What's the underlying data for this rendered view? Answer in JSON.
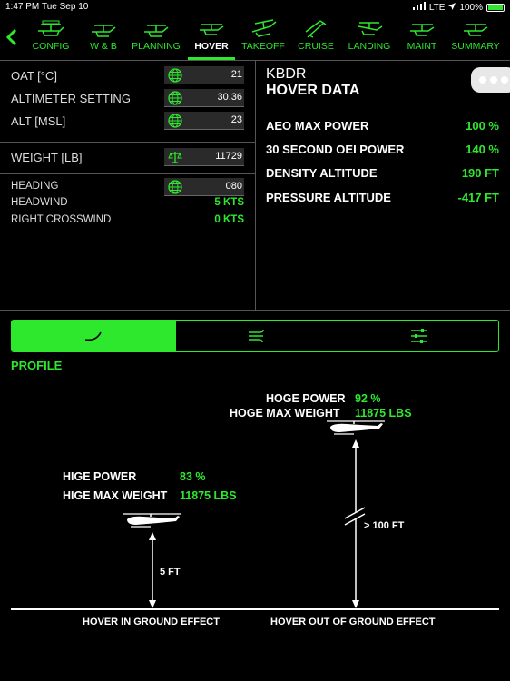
{
  "status": {
    "time": "1:47 PM",
    "date": "Tue Sep 10",
    "network": "LTE",
    "battery": "100%"
  },
  "nav": {
    "items": [
      {
        "label": "CONFIG",
        "icon": "config-icon"
      },
      {
        "label": "W & B",
        "icon": "weight-balance-icon"
      },
      {
        "label": "PLANNING",
        "icon": "planning-icon"
      },
      {
        "label": "HOVER",
        "icon": "hover-icon",
        "active": true
      },
      {
        "label": "TAKEOFF",
        "icon": "takeoff-icon"
      },
      {
        "label": "CRUISE",
        "icon": "cruise-icon"
      },
      {
        "label": "LANDING",
        "icon": "landing-icon"
      },
      {
        "label": "MAINT",
        "icon": "maint-icon"
      },
      {
        "label": "SUMMARY",
        "icon": "summary-icon"
      }
    ]
  },
  "inputs": {
    "oat": {
      "label": "OAT [°C]",
      "value": "21",
      "icon": "globe-icon"
    },
    "altimeter": {
      "label": "ALTIMETER SETTING",
      "value": "30.36",
      "icon": "globe-icon"
    },
    "alt": {
      "label": "ALT [MSL]",
      "value": "23",
      "icon": "globe-icon"
    },
    "weight": {
      "label": "WEIGHT [LB]",
      "value": "11729",
      "icon": "scale-icon"
    },
    "heading": {
      "label": "HEADING",
      "value": "080",
      "icon": "globe-icon"
    },
    "headwind": {
      "label": "HEADWIND",
      "value": "5 KTS"
    },
    "crosswind": {
      "label": "RIGHT CROSSWIND",
      "value": "0 KTS"
    }
  },
  "hover_data": {
    "airport": "KBDR",
    "title": "HOVER DATA",
    "rows": [
      {
        "label": "AEO MAX POWER",
        "value": "100 %"
      },
      {
        "label": "30 SECOND OEI POWER",
        "value": "140 %"
      },
      {
        "label": "DENSITY ALTITUDE",
        "value": "190 FT"
      },
      {
        "label": "PRESSURE ALTITUDE",
        "value": "-417 FT"
      }
    ]
  },
  "segments": {
    "selected": 0,
    "icons": [
      "profile-curve-icon",
      "wind-icon",
      "sliders-icon"
    ]
  },
  "profile": {
    "label": "PROFILE",
    "hoge": {
      "power_label": "HOGE POWER",
      "power_value": "92 %",
      "weight_label": "HOGE MAX WEIGHT",
      "weight_value": "11875 LBS",
      "height": "> 100 FT",
      "caption": "HOVER OUT OF GROUND EFFECT"
    },
    "hige": {
      "power_label": "HIGE POWER",
      "power_value": "83 %",
      "weight_label": "HIGE MAX WEIGHT",
      "weight_value": "11875 LBS",
      "height": "5 FT",
      "caption": "HOVER IN GROUND EFFECT"
    }
  },
  "colors": {
    "accent": "#2ee82e",
    "background": "#000000"
  }
}
